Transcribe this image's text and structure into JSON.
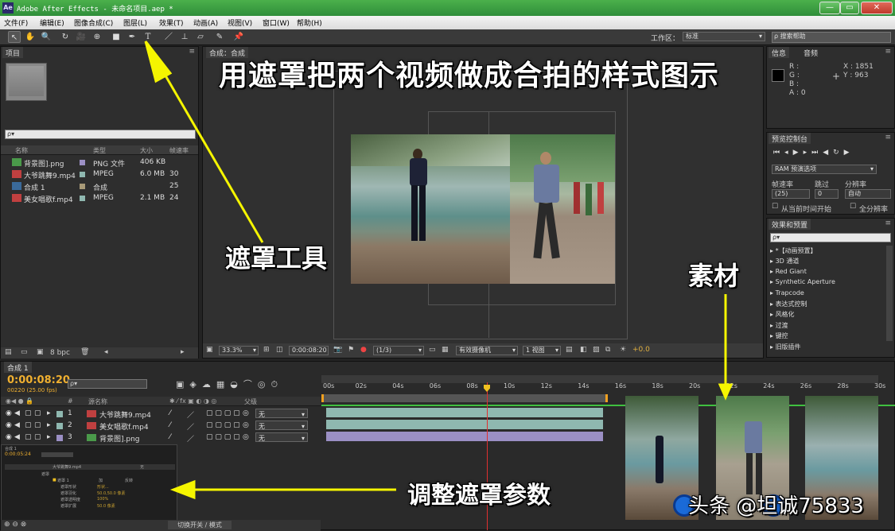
{
  "window": {
    "icon": "Ae",
    "title": "Adobe After Effects - 未命名项目.aep *",
    "buttons": [
      "—",
      "▭",
      "✕"
    ]
  },
  "menu": [
    "文件(F)",
    "编辑(E)",
    "图像合成(C)",
    "图层(L)",
    "效果(T)",
    "动画(A)",
    "视图(V)",
    "窗口(W)",
    "帮助(H)"
  ],
  "toolbar": {
    "tools": [
      "selection-tool",
      "hand-tool",
      "zoom-tool",
      "rotate-tool",
      "camera-tool",
      "pan-behind-tool",
      "rectangle-mask-tool",
      "pen-tool",
      "type-tool",
      "brush-tool",
      "clone-stamp-tool",
      "eraser-tool",
      "roto-brush-tool",
      "puppet-tool"
    ],
    "tool_glyphs": [
      "↖",
      "✋",
      "🔍",
      "↻",
      "🎥",
      "⊕",
      "■",
      "✒",
      "T",
      "／",
      "⊥",
      "▱",
      "✎",
      "📌"
    ],
    "workspace_label": "工作区：",
    "workspace_value": "标准",
    "search_help": "搜索帮助"
  },
  "project": {
    "tab": "项目",
    "search": "ρ▾",
    "columns": [
      "名称",
      "类型",
      "大小",
      "帧速率"
    ],
    "items": [
      {
        "name": "背景图].png",
        "type": "PNG 文件",
        "size": "406 KB",
        "fps": "",
        "color": "#9b8fc4",
        "icon": "png"
      },
      {
        "name": "大爷跳舞9.mp4",
        "type": "MPEG",
        "size": "6.0 MB",
        "fps": "30",
        "color": "#8fb8b0",
        "icon": "mp4"
      },
      {
        "name": "合成 1",
        "type": "合成",
        "size": "",
        "fps": "25",
        "color": "#a89a78",
        "icon": "comp"
      },
      {
        "name": "美女唱歌f.mp4",
        "type": "MPEG",
        "size": "2.1 MB",
        "fps": "24",
        "color": "#8fb8b0",
        "icon": "mp4"
      }
    ],
    "bpc": "8 bpc"
  },
  "composition": {
    "tab": "合成：合成",
    "zoom": "33.3%",
    "timecode": "0:00:08:20",
    "resolution": "(1/3)",
    "camera": "有效摄像机",
    "views": "1 视图",
    "offset": "+0.0"
  },
  "info": {
    "tabs": [
      "信息",
      "音频"
    ],
    "r": "R :",
    "g": "G :",
    "b": "B :",
    "a": "A : 0",
    "x": "X : 1851",
    "y": "Y : 963"
  },
  "preview": {
    "tab": "预览控制台",
    "ram": "RAM 预演选项",
    "labels": [
      "帧速率",
      "跳过",
      "分辨率"
    ],
    "values": [
      "(25)",
      "0",
      "自动"
    ],
    "check1": "从当前时间开始",
    "check2": "全分辨率"
  },
  "effects": {
    "tab": "效果和预置",
    "search": "ρ▾",
    "items": [
      "*【动画预置】",
      "3D 通道",
      "Red Giant",
      "Synthetic Aperture",
      "Trapcode",
      "表达式控制",
      "风格化",
      "过渡",
      "键控",
      "旧版插件"
    ]
  },
  "timeline": {
    "tab": "合成 1",
    "timecode": "0:00:08:20",
    "frames": "00220 (25.00 fps)",
    "search": "ρ▾",
    "col_name": "源名称",
    "col_parent": "父级",
    "layers": [
      {
        "num": "1",
        "name": "大爷跳舞9.mp4",
        "parent": "无",
        "color": "#8fb8b0",
        "icon": "mp4"
      },
      {
        "num": "2",
        "name": "美女唱歌f.mp4",
        "parent": "无",
        "color": "#8fb8b0",
        "icon": "mp4"
      },
      {
        "num": "3",
        "name": "背景图].png",
        "parent": "无",
        "color": "#9b8fc4",
        "icon": "png"
      }
    ],
    "ruler": [
      "00s",
      "02s",
      "04s",
      "06s",
      "08s",
      "10s",
      "12s",
      "14s",
      "16s",
      "18s",
      "20s",
      "22s",
      "24s",
      "26s",
      "28s",
      "30s"
    ],
    "toggle": "切换开关 / 模式"
  },
  "inner_timeline": {
    "tab": "合成 1",
    "timecode": "0:00:05:24",
    "layer": "大爷跳舞9.mp4",
    "parent": "无",
    "group": "遮罩",
    "mask": "遮罩 1",
    "mode": "加",
    "inverted": "反转",
    "props": [
      "遮罩形状",
      "遮罩羽化",
      "遮罩透明度",
      "遮罩扩展"
    ],
    "values": [
      "形状...",
      "50.0,50.0 像素",
      "100%",
      "50.0 像素"
    ]
  },
  "annotations": {
    "title": "用遮罩把两个视频做成合拍的样式图示",
    "mask_tool": "遮罩工具",
    "material": "素材",
    "adjust": "调整遮罩参数"
  },
  "watermark": "头条 @坦诚75833"
}
